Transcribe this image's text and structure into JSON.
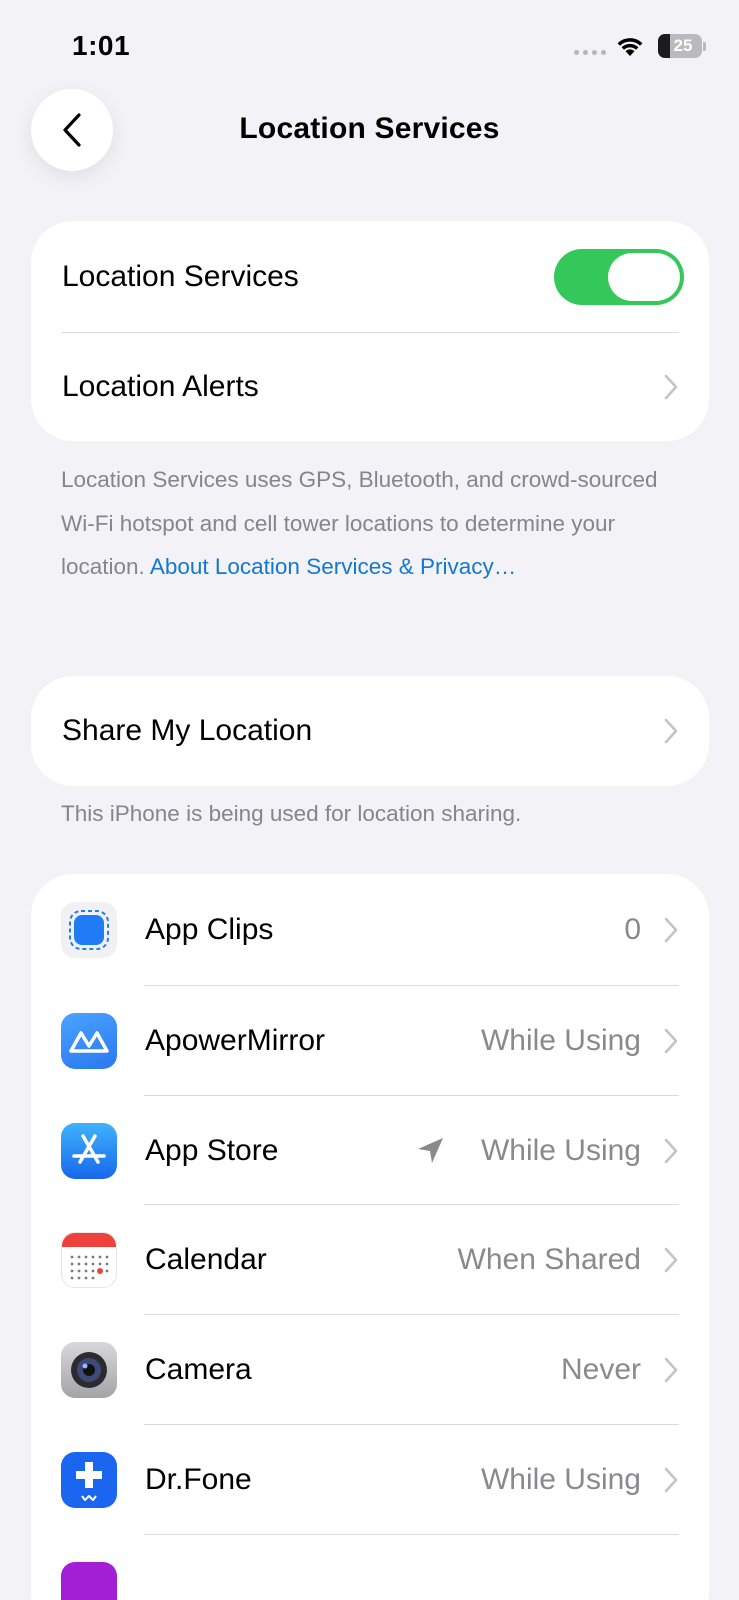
{
  "status_bar": {
    "time": "1:01",
    "battery_level": "25"
  },
  "nav": {
    "title": "Location Services"
  },
  "group_main": {
    "location_services_label": "Location Services",
    "location_services_on": true,
    "location_alerts_label": "Location Alerts"
  },
  "footnote_main": {
    "text": "Location Services uses GPS, Bluetooth, and crowd-sourced Wi-Fi hotspot and cell tower locations to determine your location. ",
    "link": "About Location Services & Privacy…"
  },
  "share": {
    "label": "Share My Location",
    "footnote": "This iPhone is being used for location sharing."
  },
  "apps": [
    {
      "name": "App Clips",
      "value": "0",
      "icon": "app-clips-icon"
    },
    {
      "name": "ApowerMirror",
      "value": "While Using",
      "icon": "apowermirror-icon"
    },
    {
      "name": "App Store",
      "value": "While Using",
      "icon": "app-store-icon",
      "location_arrow": true
    },
    {
      "name": "Calendar",
      "value": "When Shared",
      "icon": "calendar-icon"
    },
    {
      "name": "Camera",
      "value": "Never",
      "icon": "camera-icon"
    },
    {
      "name": "Dr.Fone",
      "value": "While Using",
      "icon": "drfone-icon"
    }
  ],
  "colors": {
    "background": "#f2f2f7",
    "toggle_on": "#34c759",
    "link": "#1677d2",
    "secondary_text": "#8a8a8e"
  }
}
